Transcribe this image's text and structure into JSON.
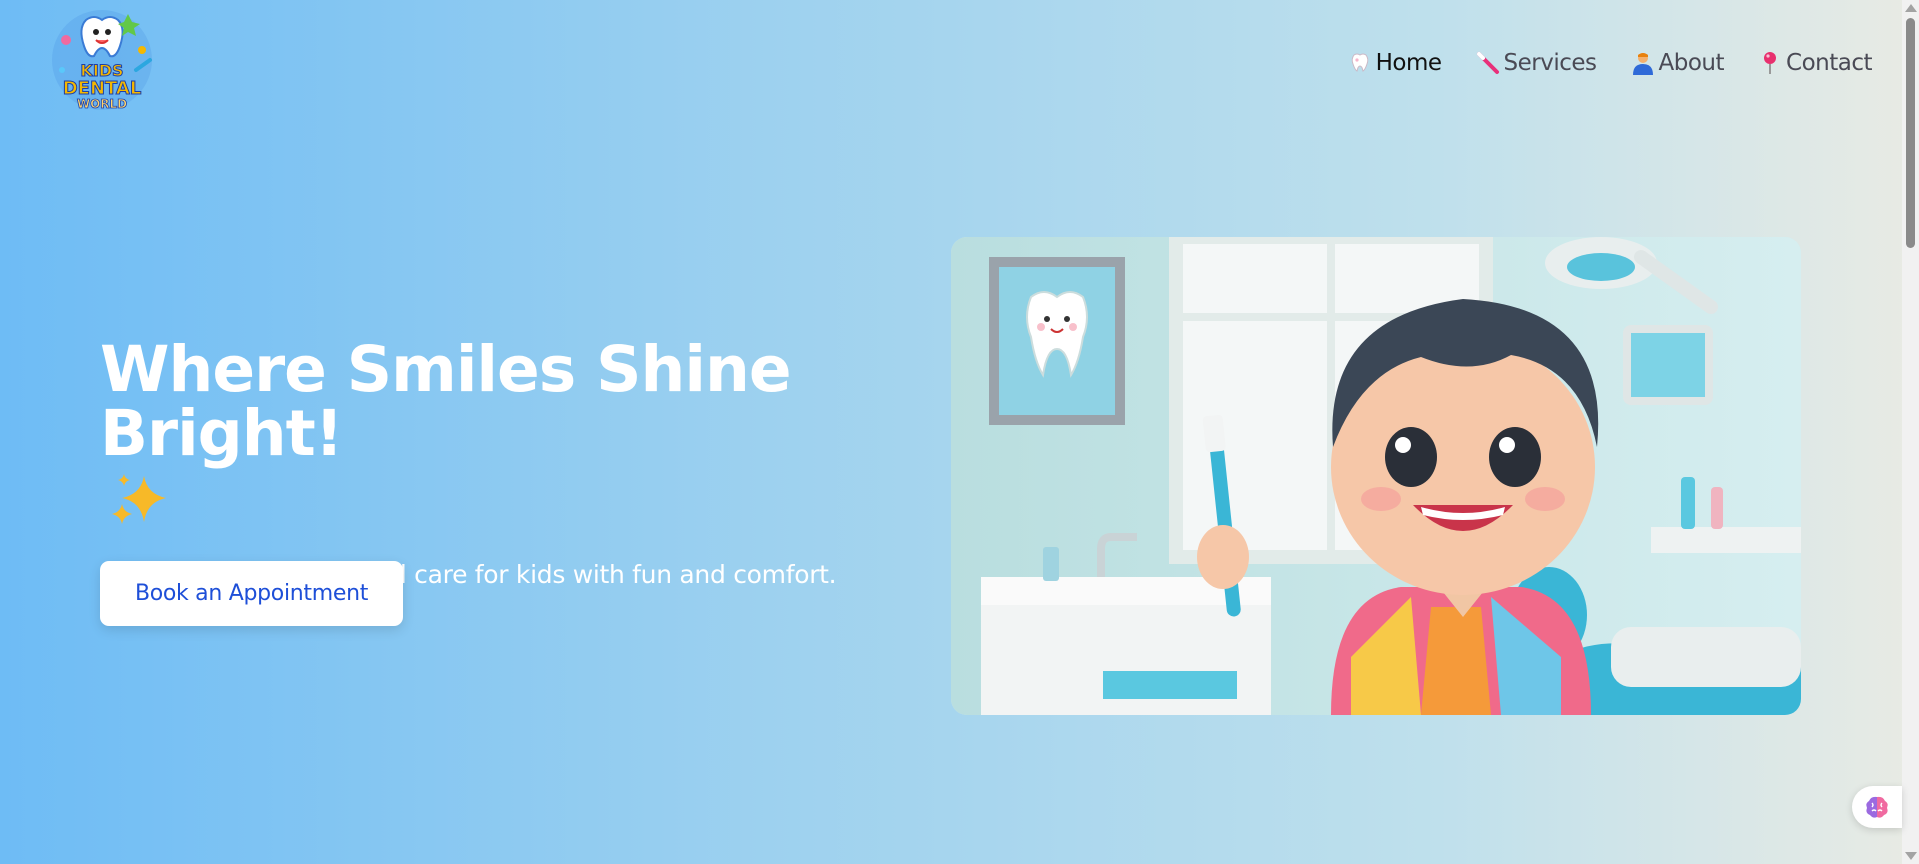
{
  "brand": {
    "logo_line1": "KIDS",
    "logo_line2": "DENTAL",
    "logo_line3": "WORLD"
  },
  "nav": {
    "items": [
      {
        "icon": "tooth-icon",
        "label": "Home",
        "active": true
      },
      {
        "icon": "toothbrush-icon",
        "label": "Services",
        "active": false
      },
      {
        "icon": "person-icon",
        "label": "About",
        "active": false
      },
      {
        "icon": "pin-icon",
        "label": "Contact",
        "active": false
      }
    ]
  },
  "hero": {
    "title": "Where Smiles Shine Bright!",
    "title_emoji": "sparkles-icon",
    "subtitle": "Providing the best dental care for kids with fun and comfort.",
    "cta_label": "Book an Appointment"
  },
  "colors": {
    "bg_left": "#6ebcf5",
    "bg_right": "#e9ebe4",
    "cta_text": "#1e4fd8"
  },
  "widget": {
    "icon": "brain-icon"
  }
}
